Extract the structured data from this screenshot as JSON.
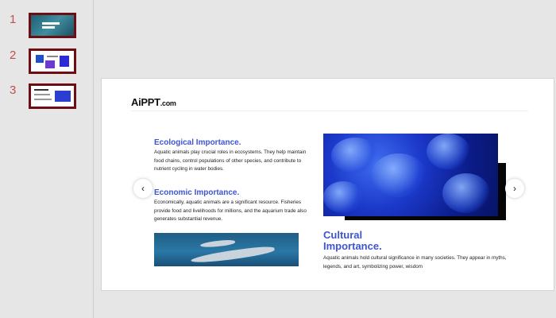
{
  "thumbnails": [
    {
      "number": "1"
    },
    {
      "number": "2"
    },
    {
      "number": "3"
    }
  ],
  "slide": {
    "logo_main": "AiPPT",
    "logo_suffix": ".com",
    "ecological_heading": "Ecological Importance.",
    "ecological_text": "Aquatic animals play crucial roles in ecosystems. They help maintain food chains, control populations of other species, and contribute to nutrient cycling in water bodies.",
    "economic_heading": "Economic Importance.",
    "economic_text": "Economically, aquatic animals are a significant resource. Fisheries provide food and livelihoods for millions, and the aquarium trade also generates substantial revenue.",
    "cultural_heading_line1": "Cultural",
    "cultural_heading_line2": "Importance.",
    "cultural_text": "Aquatic animals hold cultural significance in many societies. They appear in myths, legends, and art, symbolizing power, wisdom"
  },
  "navigation": {
    "prev_icon": "chevron-left-icon",
    "next_icon": "chevron-right-icon",
    "prev_glyph": "‹",
    "next_glyph": "›"
  },
  "colors": {
    "accent": "#3d55d3",
    "thumbnail_border": "#6b0f14",
    "slide_number": "#c0504d"
  }
}
